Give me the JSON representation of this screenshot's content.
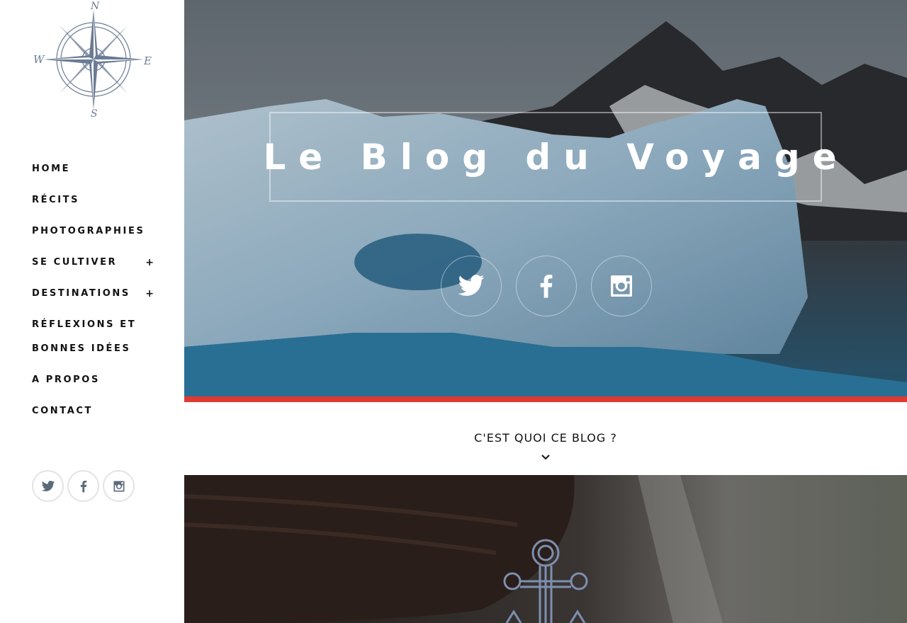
{
  "site": {
    "title": "Le Blog du Voyage",
    "accent_color": "#e03a33"
  },
  "logo": {
    "icon": "compass-rose-icon",
    "letters": {
      "n": "N",
      "s": "S",
      "e": "E",
      "w": "W"
    }
  },
  "nav": {
    "items": [
      {
        "label": "HOME"
      },
      {
        "label": "RÉCITS"
      },
      {
        "label": "PHOTOGRAPHIES"
      },
      {
        "label": "SE CULTIVER",
        "expand": "+"
      },
      {
        "label": "DESTINATIONS",
        "expand": "+"
      },
      {
        "label_line1": "RÉFLEXIONS ET",
        "label_line2": "BONNES IDÉES"
      },
      {
        "label": "A PROPOS"
      },
      {
        "label": "CONTACT"
      }
    ]
  },
  "social": [
    {
      "name": "twitter",
      "icon": "twitter-icon"
    },
    {
      "name": "facebook",
      "icon": "facebook-icon"
    },
    {
      "name": "instagram",
      "icon": "instagram-icon"
    }
  ],
  "section": {
    "heading": "C'EST QUOI CE BLOG ?",
    "chevron_icon": "chevron-down-icon",
    "emblem_icon": "anchor-icon"
  }
}
